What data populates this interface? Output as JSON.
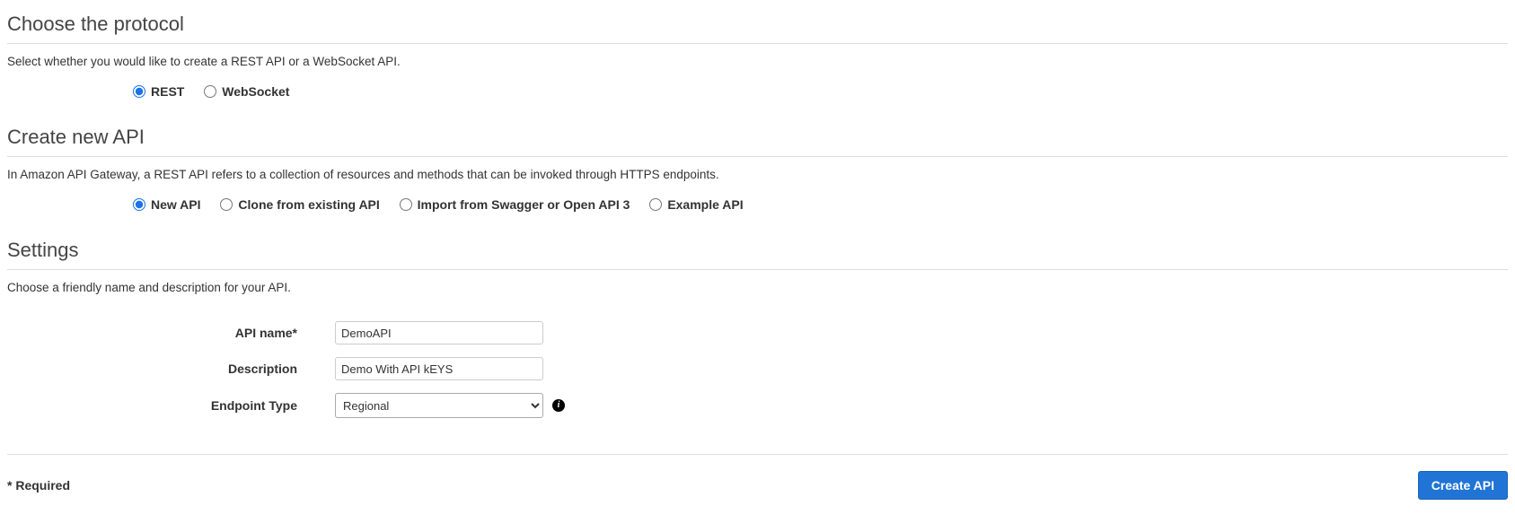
{
  "protocol": {
    "heading": "Choose the protocol",
    "desc": "Select whether you would like to create a REST API or a WebSocket API.",
    "options": {
      "rest": "REST",
      "websocket": "WebSocket"
    }
  },
  "createApi": {
    "heading": "Create new API",
    "desc": "In Amazon API Gateway, a REST API refers to a collection of resources and methods that can be invoked through HTTPS endpoints.",
    "options": {
      "newApi": "New API",
      "clone": "Clone from existing API",
      "import": "Import from Swagger or Open API 3",
      "example": "Example API"
    }
  },
  "settings": {
    "heading": "Settings",
    "desc": "Choose a friendly name and description for your API.",
    "fields": {
      "apiNameLabel": "API name*",
      "apiNameValue": "DemoAPI",
      "descriptionLabel": "Description",
      "descriptionValue": "Demo With API kEYS",
      "endpointTypeLabel": "Endpoint Type",
      "endpointTypeValue": "Regional"
    }
  },
  "footer": {
    "required": "* Required",
    "createButton": "Create API"
  }
}
